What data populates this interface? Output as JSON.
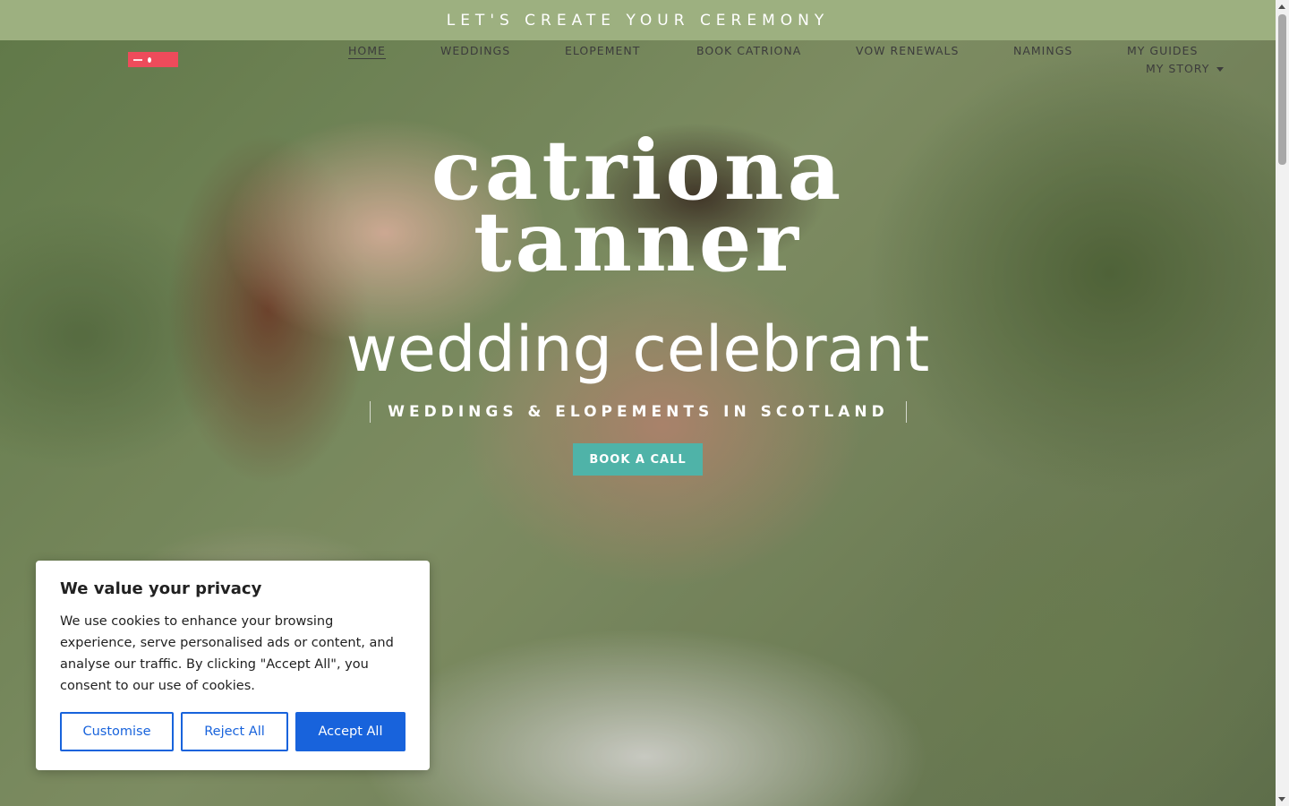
{
  "announcement": {
    "text": "LET'S CREATE YOUR CEREMONY"
  },
  "nav": {
    "logo": "site-logo",
    "items": [
      {
        "label": "HOME",
        "active": true
      },
      {
        "label": "WEDDINGS"
      },
      {
        "label": "ELOPEMENT"
      },
      {
        "label": "BOOK CATRIONA"
      },
      {
        "label": "VOW RENEWALS"
      },
      {
        "label": "NAMINGS"
      },
      {
        "label": "MY GUIDES"
      },
      {
        "label": "MY STORY",
        "has_dropdown": true
      }
    ]
  },
  "hero": {
    "name_line1": "catriona",
    "name_line2": "tanner",
    "subtitle": "wedding celebrant",
    "tagline": "WEDDINGS & ELOPEMENTS IN SCOTLAND",
    "cta_label": "BOOK A CALL"
  },
  "cookie_banner": {
    "title": "We value your privacy",
    "body": "We use cookies to enhance your browsing experience, serve personalised ads or content, and analyse our traffic. By clicking \"Accept All\", you consent to our use of cookies.",
    "customise_label": "Customise",
    "reject_label": "Reject All",
    "accept_label": "Accept All"
  },
  "colors": {
    "announcement_bg": "#9db080",
    "cta_bg": "#4fb3a8",
    "logo_bg": "#ee4b5b",
    "cookie_accent": "#1863dc"
  }
}
